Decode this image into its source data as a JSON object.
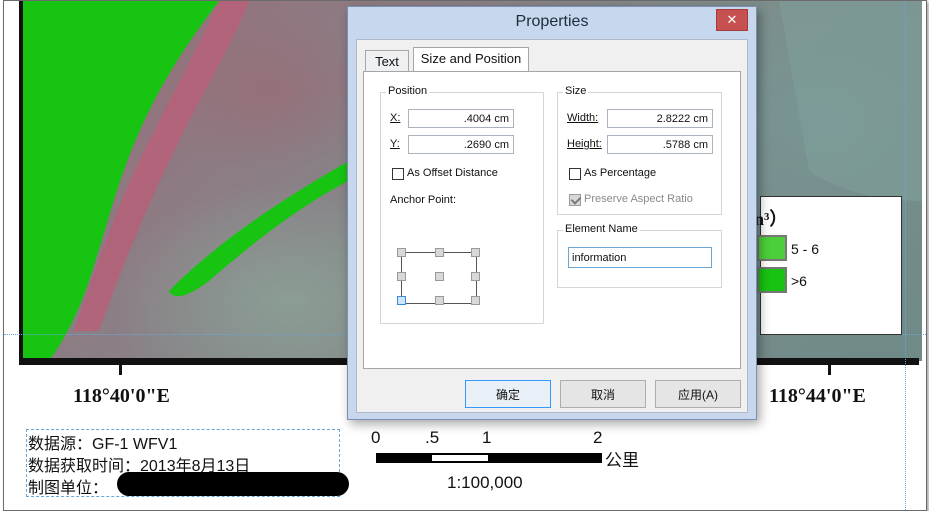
{
  "dialog": {
    "title": "Properties",
    "close_icon": "close-icon",
    "tabs": [
      {
        "label": "Text"
      },
      {
        "label": "Size and Position"
      }
    ],
    "position": {
      "group_label": "Position",
      "x_label": "X:",
      "x_value": ".4004 cm",
      "y_label": "Y:",
      "y_value": ".2690 cm",
      "offset_label": "As Offset Distance",
      "offset_checked": false,
      "anchor_label": "Anchor Point:",
      "anchor_selected": "bottom-left"
    },
    "size": {
      "group_label": "Size",
      "width_label": "Width:",
      "width_value": "2.8222 cm",
      "height_label": "Height:",
      "height_value": ".5788 cm",
      "percentage_label": "As Percentage",
      "percentage_checked": false,
      "aspect_label": "Preserve Aspect Ratio",
      "aspect_checked": true
    },
    "element_name": {
      "group_label": "Element Name",
      "value": "information"
    },
    "buttons": {
      "ok": "确定",
      "cancel": "取消",
      "apply": "应用(A)"
    }
  },
  "map": {
    "coord_left": "118°40'0\"E",
    "coord_right": "118°44'0\"E",
    "info_lines": [
      "数据源：GF-1 WFV1",
      "数据获取时间：2013年8月13日",
      "制图单位："
    ],
    "scale_ticks": [
      "0",
      ".5",
      "1",
      "2"
    ],
    "scale_unit": "公里",
    "scale_ratio": "1:100,000",
    "legend": {
      "title_fragment": "n³）",
      "items": [
        {
          "label": "5 - 6",
          "color": "#4ccf3a"
        },
        {
          "label": ">6",
          "color": "#19c312"
        }
      ]
    }
  }
}
